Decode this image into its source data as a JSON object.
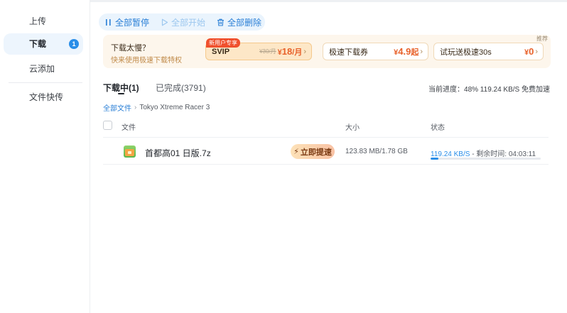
{
  "sidebar": {
    "items": [
      {
        "label": "上传",
        "active": false
      },
      {
        "label": "下载",
        "active": true,
        "badge": "1"
      },
      {
        "label": "云添加",
        "active": false
      },
      {
        "label": "文件快传",
        "active": false
      }
    ]
  },
  "toolbar": {
    "pause_all": "全部暂停",
    "start_all": "全部开始",
    "delete_all": "全部删除"
  },
  "promo": {
    "corner": "推荐",
    "title": "下载太慢？",
    "subtitle": "快来使用极速下载特权",
    "svip": {
      "tag": "新用户专享",
      "name": "SVIP",
      "old_price": "¥30/月",
      "currency": "¥",
      "price": "18",
      "unit": "/月"
    },
    "ticket": {
      "name": "极速下载券",
      "currency": "¥",
      "price": "4.9",
      "unit": "起"
    },
    "trial": {
      "name": "试玩送极速30s",
      "currency": "¥",
      "price": "0"
    }
  },
  "tabs": {
    "downloading": "下载中(1)",
    "completed": "已完成(3791)"
  },
  "summary": {
    "text": "当前进度：48%   119.24 KB/S   免费加速"
  },
  "breadcrumb": {
    "root": "全部文件",
    "current": "Tokyo Xtreme Racer 3"
  },
  "table": {
    "headers": {
      "file": "文件",
      "size": "大小",
      "status": "状态"
    },
    "rows": [
      {
        "name": "首都高01 日版.7z",
        "boost": "立即提速",
        "size": "123.83 MB/1.78 GB",
        "speed": "119.24 KB/S",
        "remaining": " - 剩余时间: 04:03:11",
        "progress": 0.07
      }
    ]
  },
  "colors": {
    "accent": "#2a8ee8",
    "promo_price": "#e8612a"
  }
}
